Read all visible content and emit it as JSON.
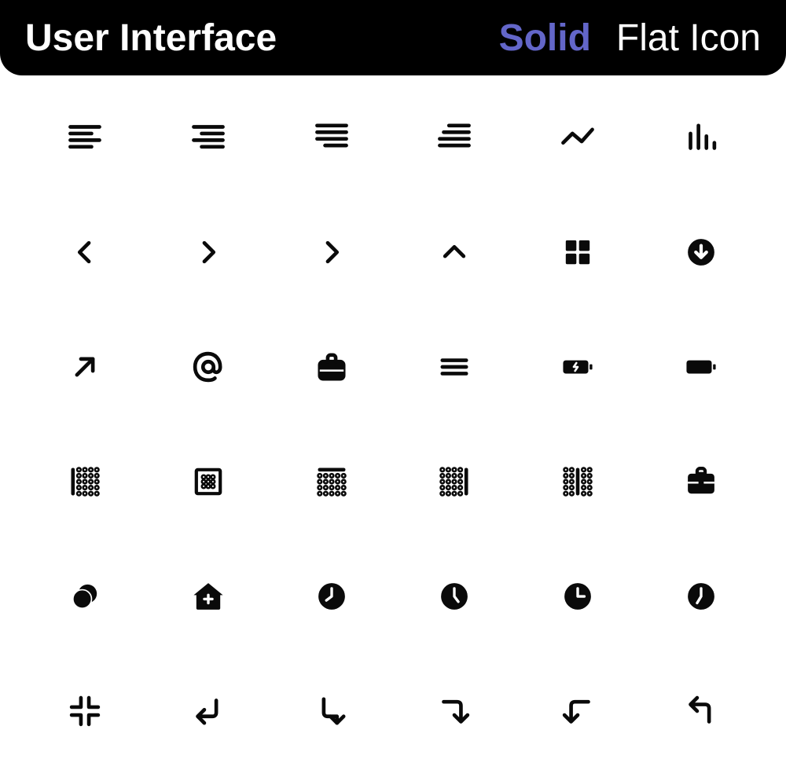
{
  "header": {
    "title": "User Interface",
    "solid": "Solid",
    "flat": "Flat Icon"
  },
  "icons": [
    [
      "align-left",
      "align-right",
      "align-justify-right",
      "align-decrease",
      "line-chart",
      "bar-chart"
    ],
    [
      "chevron-left",
      "chevron-right",
      "chevron-right-2",
      "chevron-up",
      "grid",
      "arrow-down-circle"
    ],
    [
      "arrow-up-right",
      "at-sign",
      "briefcase",
      "menu",
      "battery-charging",
      "battery"
    ],
    [
      "border-left",
      "border-box",
      "border-top",
      "border-right",
      "border-vertical",
      "briefcase-solid"
    ],
    [
      "coins",
      "home-plus",
      "clock-1",
      "clock-2",
      "clock-3",
      "clock-4"
    ],
    [
      "minimize",
      "enter",
      "arrow-down-right-turn",
      "arrow-right-down-turn",
      "arrow-left-down-turn",
      "arrow-up-left-turn"
    ]
  ]
}
